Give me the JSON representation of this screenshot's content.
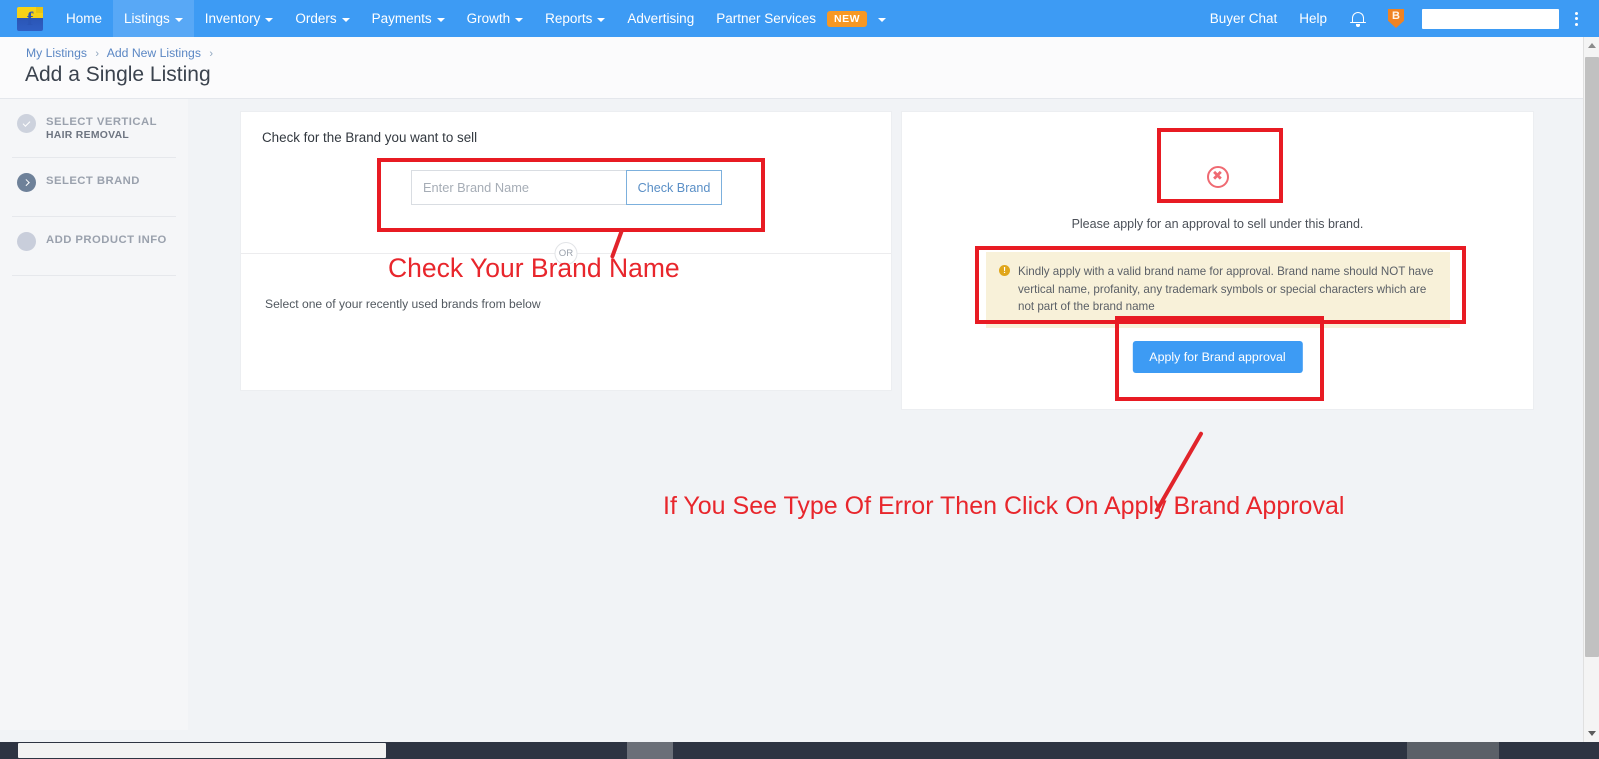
{
  "topnav": {
    "logo_letter": "f",
    "items": [
      {
        "label": "Home",
        "caret": false,
        "active": false
      },
      {
        "label": "Listings",
        "caret": true,
        "active": true
      },
      {
        "label": "Inventory",
        "caret": true,
        "active": false
      },
      {
        "label": "Orders",
        "caret": true,
        "active": false
      },
      {
        "label": "Payments",
        "caret": true,
        "active": false
      },
      {
        "label": "Growth",
        "caret": true,
        "active": false
      },
      {
        "label": "Reports",
        "caret": true,
        "active": false
      },
      {
        "label": "Advertising",
        "caret": false,
        "active": false
      },
      {
        "label": "Partner Services",
        "caret": true,
        "active": false,
        "badge": "NEW"
      }
    ],
    "right": {
      "buyer_chat": "Buyer Chat",
      "help": "Help",
      "notifications_icon": "bell-icon",
      "shield_letter": "B",
      "account_value": "",
      "kebab_icon": "kebab-menu-icon"
    },
    "bg_color": "#3d9bf4",
    "badge_color": "#f79824"
  },
  "header": {
    "breadcrumb": [
      {
        "label": "My Listings"
      },
      {
        "label": "Add New Listings"
      }
    ],
    "breadcrumb_separator": "›",
    "page_title": "Add a Single Listing"
  },
  "rail": {
    "steps": [
      {
        "label": "SELECT VERTICAL",
        "sublabel": "HAIR REMOVAL",
        "state": "done",
        "icon": "check-icon"
      },
      {
        "label": "SELECT BRAND",
        "sublabel": "",
        "state": "current",
        "icon": "chevron-right-icon"
      },
      {
        "label": "ADD PRODUCT INFO",
        "sublabel": "",
        "state": "pending",
        "icon": "dot-icon"
      }
    ]
  },
  "left_card": {
    "title": "Check for the Brand you want to sell",
    "brand_input": {
      "placeholder": "Enter Brand Name",
      "value": ""
    },
    "check_button": "Check Brand",
    "or_label": "OR",
    "recent_label": "Select one of your recently used brands from below"
  },
  "right_card": {
    "status_icon": "error-circle-x-icon",
    "status_color": "#ef6a72",
    "message": "Please apply for an approval to sell under this brand.",
    "warning_icon": "warning-exclamation-icon",
    "warning_color": "#e0a61b",
    "warning_text": "Kindly apply with a valid brand name for approval. Brand name should NOT have vertical name, profanity, any trademark symbols or special characters which are not part of the brand name",
    "apply_button": "Apply for Brand approval",
    "apply_button_color": "#3d9bf4"
  },
  "annotations": {
    "color": "#e8262c",
    "check_brand_name": "Check Your Brand Name",
    "bottom_instruction": "If You See Type Of Error Then Click On Apply Brand Approval"
  },
  "scrollbars": {
    "vertical_up_icon": "caret-up-icon",
    "vertical_down_icon": "caret-down-icon"
  }
}
